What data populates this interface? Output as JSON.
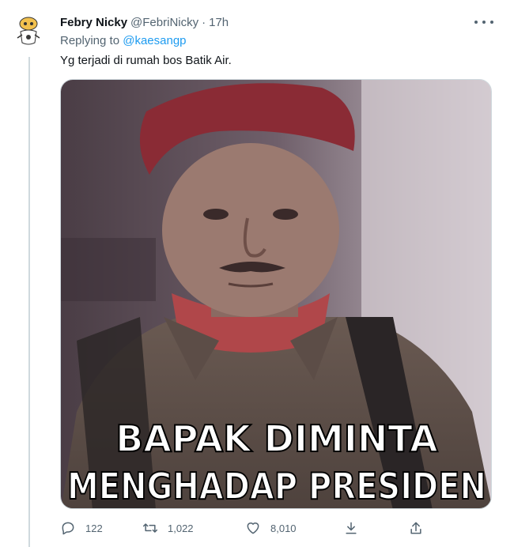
{
  "tweet": {
    "author_name": "Febry Nicky",
    "author_handle": "@FebriNicky",
    "separator": "·",
    "time": "17h",
    "replying_prefix": "Replying to",
    "replying_to": "@kaesangp",
    "text": "Yg terjadi di rumah bos Batik Air.",
    "meme_caption_line1": "BAPAK DIMINTA",
    "meme_caption_line2": "MENGHADAP PRESIDEN"
  },
  "actions": {
    "reply_count": "122",
    "retweet_count": "1,022",
    "like_count": "8,010"
  },
  "icons": {
    "reply": "reply-icon",
    "retweet": "retweet-icon",
    "like": "heart-icon",
    "download": "download-icon",
    "share": "share-icon",
    "more": "more-icon"
  },
  "colors": {
    "link": "#1d9bf0",
    "secondary_text": "#536471",
    "beret": "#8a2b35"
  }
}
